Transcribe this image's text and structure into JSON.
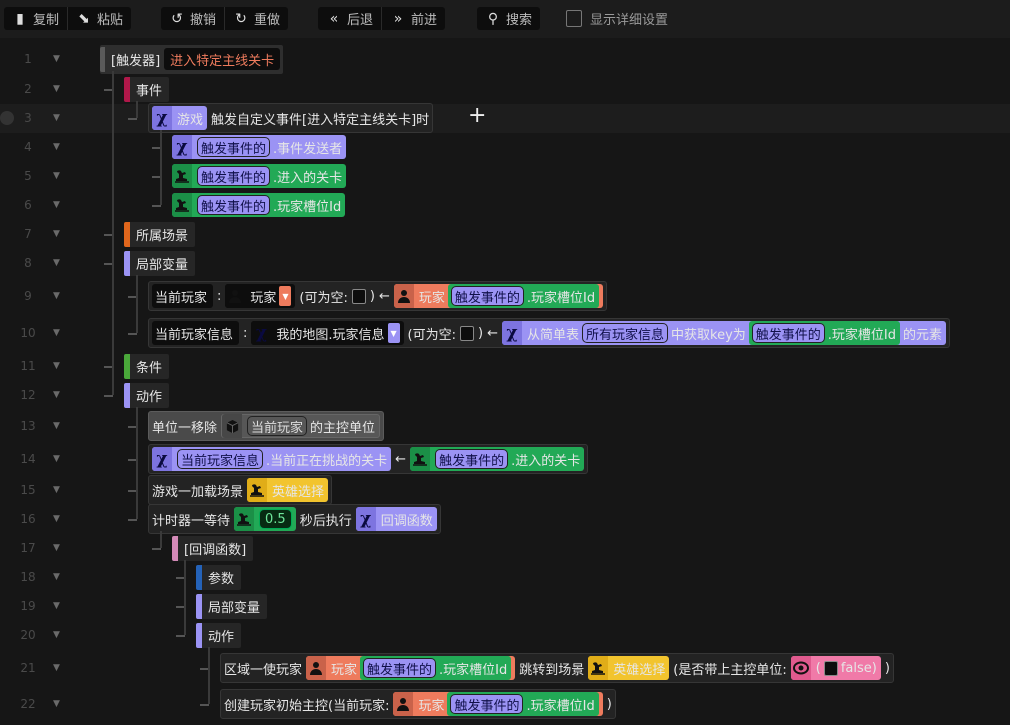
{
  "toolbar": {
    "groups": [
      [
        {
          "icon": "copy-icon",
          "glyph": "▮",
          "label": "复制"
        },
        {
          "icon": "paste-icon",
          "glyph": "⬊",
          "label": "粘贴"
        }
      ],
      [
        {
          "icon": "undo-icon",
          "glyph": "↺",
          "label": "撤销"
        },
        {
          "icon": "redo-icon",
          "glyph": "↻",
          "label": "重做"
        }
      ],
      [
        {
          "icon": "back-icon",
          "glyph": "«",
          "label": "后退"
        },
        {
          "icon": "forward-icon",
          "glyph": "»",
          "label": "前进"
        }
      ],
      [
        {
          "icon": "search-icon",
          "glyph": "⚲",
          "label": "搜索"
        }
      ]
    ],
    "detail_label": "显示详细设置",
    "detail_checked": false
  },
  "colors": {
    "purple": "#9b93f4",
    "green": "#22a956",
    "orange": "#ee7b5d",
    "yellow": "#f2c42e",
    "pink": "#f07aa8",
    "event_bar": "#b0184a",
    "scene_bar": "#e0661c",
    "cond_bar": "#4aa83a",
    "callback_bar": "#d48ab8",
    "param_bar": "#2462b8",
    "trigger_bar": "#5a5a5a"
  },
  "rows": [
    {
      "num": "1",
      "level": 0,
      "kind": "trigger",
      "text": "[触发器]",
      "name": "进入特定主线关卡"
    },
    {
      "num": "2",
      "level": 1,
      "kind": "label",
      "bar": "event_bar",
      "text": "事件"
    },
    {
      "num": "3",
      "level": 2,
      "kind": "block",
      "hl": true,
      "plus": "+",
      "parts": [
        {
          "t": "chip",
          "c": "purple",
          "icon": "x",
          "parts": [
            {
              "t": "text",
              "v": "游戏"
            }
          ]
        },
        {
          "t": "text",
          "v": "触发自定义事件[进入特定主线关卡]时"
        }
      ]
    },
    {
      "num": "4",
      "level": 3,
      "kind": "block",
      "bare": true,
      "parts": [
        {
          "t": "chip",
          "c": "purple",
          "icon": "x",
          "parts": [
            {
              "t": "pill",
              "v": "触发事件的"
            },
            {
              "t": "text",
              "v": ".事件发送者"
            }
          ]
        }
      ]
    },
    {
      "num": "5",
      "level": 3,
      "kind": "block",
      "bare": true,
      "parts": [
        {
          "t": "chip",
          "c": "green",
          "icon": "dino",
          "parts": [
            {
              "t": "pill",
              "v": "触发事件的"
            },
            {
              "t": "text",
              "v": ".进入的关卡"
            }
          ]
        }
      ]
    },
    {
      "num": "6",
      "level": 3,
      "kind": "block",
      "bare": true,
      "parts": [
        {
          "t": "chip",
          "c": "green",
          "icon": "dino",
          "parts": [
            {
              "t": "pill",
              "v": "触发事件的"
            },
            {
              "t": "text",
              "v": ".玩家槽位Id"
            }
          ]
        }
      ]
    },
    {
      "num": "7",
      "level": 1,
      "kind": "label",
      "bar": "scene_bar",
      "text": "所属场景"
    },
    {
      "num": "8",
      "level": 1,
      "kind": "label",
      "bar": "purple",
      "text": "局部变量"
    },
    {
      "num": "9",
      "level": 2,
      "kind": "block",
      "parts": [
        {
          "t": "chip",
          "c": "dark",
          "parts": [
            {
              "t": "text",
              "v": "当前玩家"
            }
          ]
        },
        {
          "t": "text",
          "v": ":"
        },
        {
          "t": "chip",
          "c": "darko",
          "icon": "person",
          "parts": [
            {
              "t": "text",
              "v": "玩家"
            },
            {
              "t": "dd",
              "c": "orange"
            }
          ]
        },
        {
          "t": "text",
          "v": "(可为空:"
        },
        {
          "t": "cbx"
        },
        {
          "t": "text",
          "v": ")"
        },
        {
          "t": "text",
          "v": "←"
        },
        {
          "t": "chip",
          "c": "orange",
          "icon": "person",
          "parts": [
            {
              "t": "text",
              "v": "玩家"
            },
            {
              "t": "chip",
              "c": "green",
              "parts": [
                {
                  "t": "pill",
                  "v": "触发事件的"
                },
                {
                  "t": "text",
                  "v": ".玩家槽位Id"
                }
              ]
            }
          ]
        }
      ]
    },
    {
      "num": "10",
      "level": 2,
      "kind": "block",
      "parts": [
        {
          "t": "chip",
          "c": "dark",
          "parts": [
            {
              "t": "text",
              "v": "当前玩家信息"
            }
          ]
        },
        {
          "t": "text",
          "v": ":"
        },
        {
          "t": "chip",
          "c": "darkp",
          "icon": "x",
          "parts": [
            {
              "t": "text",
              "v": "我的地图.玩家信息"
            },
            {
              "t": "dd",
              "c": "purple"
            }
          ]
        },
        {
          "t": "text",
          "v": "(可为空:"
        },
        {
          "t": "cbx"
        },
        {
          "t": "text",
          "v": ")"
        },
        {
          "t": "text",
          "v": "←"
        },
        {
          "t": "chip",
          "c": "purple",
          "icon": "x",
          "parts": [
            {
              "t": "text",
              "v": "从简单表"
            },
            {
              "t": "pill",
              "v": "所有玩家信息"
            },
            {
              "t": "text",
              "v": "中获取key为"
            },
            {
              "t": "chip",
              "c": "green",
              "parts": [
                {
                  "t": "pill",
                  "v": "触发事件的"
                },
                {
                  "t": "text",
                  "v": ".玩家槽位Id"
                }
              ]
            },
            {
              "t": "text",
              "v": "的元素"
            }
          ]
        }
      ]
    },
    {
      "num": "11",
      "level": 1,
      "kind": "label",
      "bar": "cond_bar",
      "text": "条件"
    },
    {
      "num": "12",
      "level": 1,
      "kind": "label",
      "bar": "purple",
      "text": "动作"
    },
    {
      "num": "13",
      "level": 2,
      "kind": "block",
      "gray": true,
      "parts": [
        {
          "t": "text",
          "v": "单位一移除"
        },
        {
          "t": "chip",
          "c": "gray",
          "icon": "cube",
          "parts": [
            {
              "t": "pill",
              "v": "当前玩家"
            },
            {
              "t": "text",
              "v": "的主控单位"
            }
          ]
        }
      ]
    },
    {
      "num": "14",
      "level": 2,
      "kind": "block",
      "parts": [
        {
          "t": "chip",
          "c": "purple",
          "icon": "x",
          "parts": [
            {
              "t": "pill",
              "v": "当前玩家信息"
            },
            {
              "t": "text",
              "v": ".当前正在挑战的关卡"
            }
          ]
        },
        {
          "t": "text",
          "v": "←"
        },
        {
          "t": "chip",
          "c": "green",
          "icon": "dino",
          "parts": [
            {
              "t": "pill",
              "v": "触发事件的"
            },
            {
              "t": "text",
              "v": ".进入的关卡"
            }
          ]
        }
      ]
    },
    {
      "num": "15",
      "level": 2,
      "kind": "block",
      "parts": [
        {
          "t": "text",
          "v": "游戏一加载场景"
        },
        {
          "t": "chip",
          "c": "yellow",
          "icon": "dino",
          "parts": [
            {
              "t": "text",
              "v": "英雄选择"
            }
          ]
        }
      ]
    },
    {
      "num": "16",
      "level": 2,
      "kind": "block",
      "parts": [
        {
          "t": "text",
          "v": "计时器一等待"
        },
        {
          "t": "chip",
          "c": "green",
          "icon": "dino",
          "parts": [
            {
              "t": "val",
              "v": "0.5"
            }
          ]
        },
        {
          "t": "text",
          "v": "秒后执行"
        },
        {
          "t": "chip",
          "c": "purple",
          "icon": "x",
          "parts": [
            {
              "t": "text",
              "v": "回调函数"
            }
          ]
        }
      ]
    },
    {
      "num": "17",
      "level": 3,
      "kind": "label",
      "bar": "callback_bar",
      "text": "[回调函数]"
    },
    {
      "num": "18",
      "level": 4,
      "kind": "label",
      "bar": "param_bar",
      "text": "参数"
    },
    {
      "num": "19",
      "level": 4,
      "kind": "label",
      "bar": "purple",
      "text": "局部变量"
    },
    {
      "num": "20",
      "level": 4,
      "kind": "label",
      "bar": "purple",
      "text": "动作"
    },
    {
      "num": "21",
      "level": 5,
      "kind": "block",
      "parts": [
        {
          "t": "text",
          "v": "区域一使玩家"
        },
        {
          "t": "chip",
          "c": "orange",
          "icon": "person",
          "parts": [
            {
              "t": "text",
              "v": "玩家"
            },
            {
              "t": "chip",
              "c": "green",
              "parts": [
                {
                  "t": "pill",
                  "v": "触发事件的"
                },
                {
                  "t": "text",
                  "v": ".玩家槽位Id"
                }
              ]
            }
          ]
        },
        {
          "t": "text",
          "v": "跳转到场景"
        },
        {
          "t": "chip",
          "c": "yellow",
          "icon": "dino",
          "parts": [
            {
              "t": "text",
              "v": "英雄选择"
            }
          ]
        },
        {
          "t": "text",
          "v": "(是否带上主控单位:"
        },
        {
          "t": "chip",
          "c": "pink",
          "icon": "eye",
          "parts": [
            {
              "t": "text",
              "v": "("
            },
            {
              "t": "cbx"
            },
            {
              "t": "text",
              "v": "false)"
            }
          ]
        },
        {
          "t": "text",
          "v": ")"
        }
      ]
    },
    {
      "num": "22",
      "level": 5,
      "kind": "block",
      "parts": [
        {
          "t": "text",
          "v": "创建玩家初始主控(当前玩家:"
        },
        {
          "t": "chip",
          "c": "orange",
          "icon": "person",
          "parts": [
            {
              "t": "text",
              "v": "玩家"
            },
            {
              "t": "chip",
              "c": "green",
              "parts": [
                {
                  "t": "pill",
                  "v": "触发事件的"
                },
                {
                  "t": "text",
                  "v": ".玩家槽位Id"
                }
              ]
            }
          ]
        },
        {
          "t": "text",
          "v": ")"
        }
      ]
    }
  ]
}
